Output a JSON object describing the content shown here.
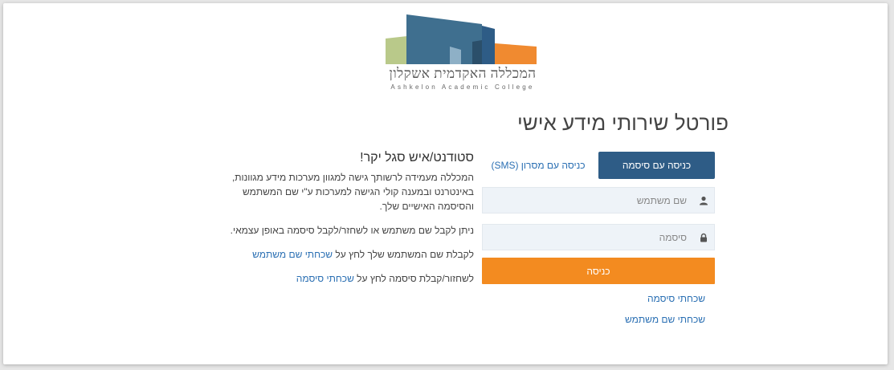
{
  "logo": {
    "hebrew": "המכללה האקדמית אשקלון",
    "english": "Ashkelon Academic College"
  },
  "portal_title": "פורטל שירותי מידע אישי",
  "login": {
    "tab_password": "כניסה עם סיסמה",
    "tab_sms": "כניסה עם מסרון (SMS)",
    "username_placeholder": "שם משתמש",
    "password_placeholder": "סיסמה",
    "submit": "כניסה",
    "forgot_password": "שכחתי סיסמה",
    "forgot_username": "שכחתי שם משתמש"
  },
  "info": {
    "heading": "סטודנט/איש סגל יקר!",
    "p1": "המכללה מעמידה לרשותך גישה למגוון מערכות מידע מגוונות, באינטרנט ובמענה קולי הגישה למערכות ע\"י שם המשתמש והסיסמה האישיים שלך.",
    "p2": "ניתן לקבל שם משתמש או לשחזר/לקבל סיסמה באופן עצמאי.",
    "p3_text": "לקבלת שם המשתמש שלך לחץ על ",
    "p3_link": "שכחתי שם משתמש",
    "p4_text": "לשחזור/קבלת סיסמה לחץ על ",
    "p4_link": "שכחתי סיסמה"
  },
  "colors": {
    "primary_blue": "#2e5c86",
    "accent_orange": "#f38b20",
    "link_blue": "#2a6fb3"
  },
  "icons": [
    "user-icon",
    "lock-icon"
  ]
}
